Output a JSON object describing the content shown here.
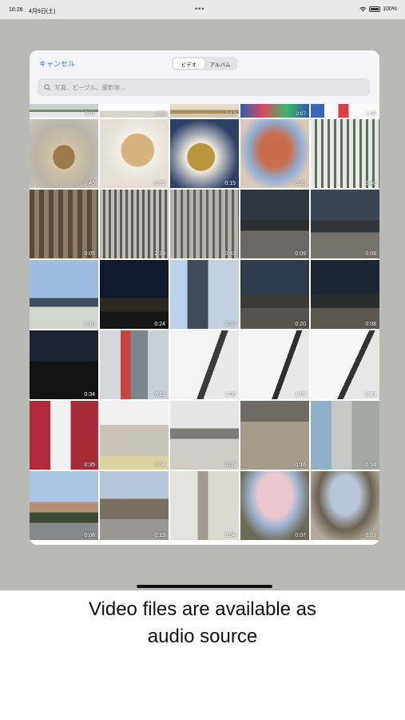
{
  "status_bar": {
    "time": "16:28",
    "date": "4月9日(土)",
    "dots": "•••",
    "battery": "100%"
  },
  "picker": {
    "cancel_label": "キャンセル",
    "tabs": [
      {
        "label": "ビデオ",
        "active": true
      },
      {
        "label": "アルバム",
        "active": false
      }
    ],
    "search_placeholder": "写真、ピープル、撮影地..."
  },
  "thumbnails": [
    {
      "duration": "0:03",
      "scene": "s0"
    },
    {
      "duration": "1:49",
      "scene": "s1"
    },
    {
      "duration": "0:12",
      "scene": "s2"
    },
    {
      "duration": "2:07",
      "scene": "s3"
    },
    {
      "duration": "1:35",
      "scene": "s4"
    },
    {
      "duration": "0:45",
      "scene": "s5"
    },
    {
      "duration": "0:39",
      "scene": "s6"
    },
    {
      "duration": "0:15",
      "scene": "s7"
    },
    {
      "duration": "0:28",
      "scene": "s8"
    },
    {
      "duration": "0:46",
      "scene": "s9"
    },
    {
      "duration": "0:05",
      "scene": "s10"
    },
    {
      "duration": "2:39",
      "scene": "s11"
    },
    {
      "duration": "0:43",
      "scene": "s12"
    },
    {
      "duration": "0:09",
      "scene": "s13"
    },
    {
      "duration": "0:09",
      "scene": "s14"
    },
    {
      "duration": "0:10",
      "scene": "s15"
    },
    {
      "duration": "0:24",
      "scene": "s16"
    },
    {
      "duration": "0:30",
      "scene": "s17"
    },
    {
      "duration": "0:20",
      "scene": "s18"
    },
    {
      "duration": "0:08",
      "scene": "s19"
    },
    {
      "duration": "0:34",
      "scene": "s20"
    },
    {
      "duration": "0:11",
      "scene": "s21"
    },
    {
      "duration": "1:06",
      "scene": "s22"
    },
    {
      "duration": "1:05",
      "scene": "s23"
    },
    {
      "duration": "0:21",
      "scene": "s24"
    },
    {
      "duration": "0:35",
      "scene": "s25"
    },
    {
      "duration": "0:04",
      "scene": "s26"
    },
    {
      "duration": "0:05",
      "scene": "s27"
    },
    {
      "duration": "0:16",
      "scene": "s28"
    },
    {
      "duration": "0:14",
      "scene": "s29"
    },
    {
      "duration": "0:08",
      "scene": "s30"
    },
    {
      "duration": "0:19",
      "scene": "s31"
    },
    {
      "duration": "0:04",
      "scene": "s32"
    },
    {
      "duration": "0:07",
      "scene": "s33"
    },
    {
      "duration": "0:03",
      "scene": "s34"
    }
  ],
  "caption": {
    "line1": "Video files are available as",
    "line2": "audio source"
  },
  "colors": {
    "accent": "#3f80e3",
    "dim_background": "#b9bab6"
  }
}
